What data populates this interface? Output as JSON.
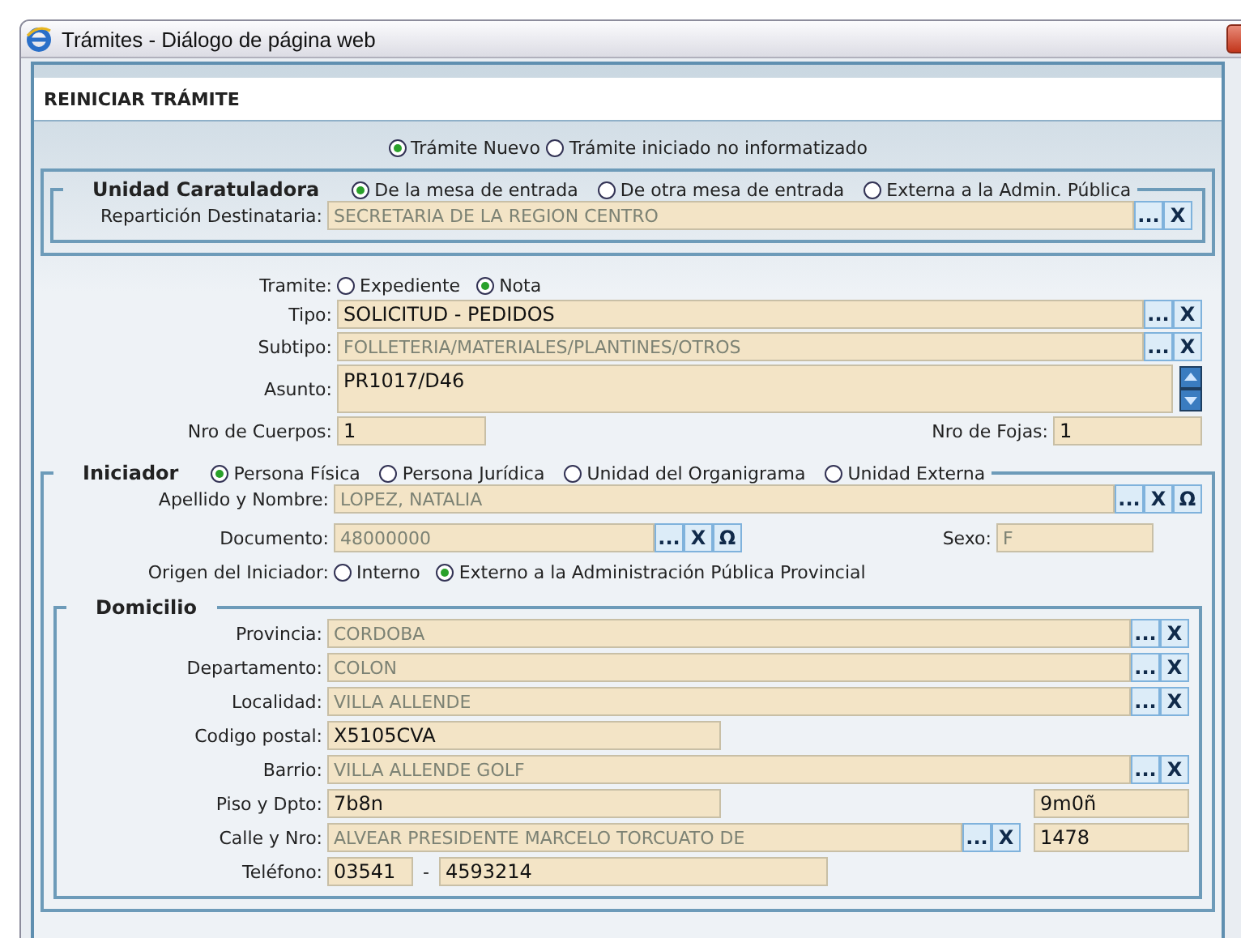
{
  "window": {
    "title": "Trámites - Diálogo de página web"
  },
  "header": "REINICIAR TRÁMITE",
  "tramite_type": [
    {
      "label": "Trámite Nuevo",
      "selected": true
    },
    {
      "label": "Trámite iniciado no informatizado",
      "selected": false
    }
  ],
  "unidad_caratuladora": {
    "legend": "Unidad Caratuladora",
    "options": [
      {
        "label": "De la mesa de entrada",
        "selected": true
      },
      {
        "label": "De otra mesa de entrada",
        "selected": false
      },
      {
        "label": "Externa a la Admin. Pública",
        "selected": false
      }
    ],
    "rows": [
      {
        "kind": "lookup",
        "label": "Repartición Destinataria:",
        "value": "SECRETARIA DE LA REGION CENTRO",
        "readonly": true,
        "buttons": [
          "...",
          "X"
        ]
      }
    ]
  },
  "tramite": {
    "rows": [
      {
        "kind": "radios",
        "label": "Tramite:",
        "options": [
          {
            "label": "Expediente",
            "selected": false
          },
          {
            "label": "Nota",
            "selected": true
          }
        ]
      },
      {
        "kind": "lookup",
        "label": "Tipo:",
        "value": "SOLICITUD - PEDIDOS",
        "readonly": false,
        "buttons": [
          "...",
          "X"
        ]
      },
      {
        "kind": "lookup",
        "label": "Subtipo:",
        "value": "FOLLETERIA/MATERIALES/PLANTINES/OTROS",
        "readonly": true,
        "buttons": [
          "...",
          "X"
        ]
      },
      {
        "kind": "textarea",
        "label": "Asunto:",
        "value": "PR1017/D46"
      },
      {
        "kind": "counts",
        "label": "Nro de Cuerpos:",
        "value": "1",
        "label2": "Nro de Fojas:",
        "value2": "1"
      }
    ]
  },
  "iniciador": {
    "legend": "Iniciador",
    "options": [
      {
        "label": "Persona Física",
        "selected": true
      },
      {
        "label": "Persona Jurídica",
        "selected": false
      },
      {
        "label": "Unidad del Organigrama",
        "selected": false
      },
      {
        "label": "Unidad Externa",
        "selected": false
      }
    ],
    "rows": [
      {
        "kind": "lookup",
        "label": "Apellido y Nombre:",
        "value": "LOPEZ, NATALIA",
        "readonly": true,
        "buttons": [
          "...",
          "X",
          "Ω"
        ]
      },
      {
        "kind": "document",
        "label": "Documento:",
        "value": "48000000",
        "readonly": true,
        "buttons": [
          "...",
          "X",
          "Ω"
        ],
        "label2": "Sexo:",
        "value2": "F"
      },
      {
        "kind": "radios",
        "label": "Origen del Iniciador:",
        "options": [
          {
            "label": "Interno",
            "selected": false
          },
          {
            "label": "Externo a la Administración Pública Provincial",
            "selected": true
          }
        ]
      }
    ],
    "domicilio": {
      "legend": "Domicilio",
      "rows": [
        {
          "kind": "lookup",
          "label": "Provincia:",
          "value": "CORDOBA",
          "readonly": true,
          "buttons": [
            "...",
            "X"
          ]
        },
        {
          "kind": "lookup",
          "label": "Departamento:",
          "value": "COLON",
          "readonly": true,
          "buttons": [
            "...",
            "X"
          ]
        },
        {
          "kind": "lookup",
          "label": "Localidad:",
          "value": "VILLA ALLENDE",
          "readonly": true,
          "buttons": [
            "...",
            "X"
          ]
        },
        {
          "kind": "text",
          "label": "Codigo postal:",
          "value": "X5105CVA"
        },
        {
          "kind": "lookup",
          "label": "Barrio:",
          "value": "VILLA ALLENDE GOLF",
          "readonly": true,
          "buttons": [
            "...",
            "X"
          ]
        },
        {
          "kind": "text",
          "label": "Piso y Dpto:",
          "value": "7b8n",
          "value2": "9m0ñ"
        },
        {
          "kind": "street",
          "label": "Calle y Nro:",
          "value": "ALVEAR PRESIDENTE MARCELO TORCUATO DE",
          "readonly": true,
          "buttons": [
            "...",
            "X"
          ],
          "value2": "1478"
        },
        {
          "kind": "phone",
          "label": "Teléfono:",
          "value": "03541",
          "separator": "-",
          "value2": "4593214"
        }
      ]
    }
  }
}
